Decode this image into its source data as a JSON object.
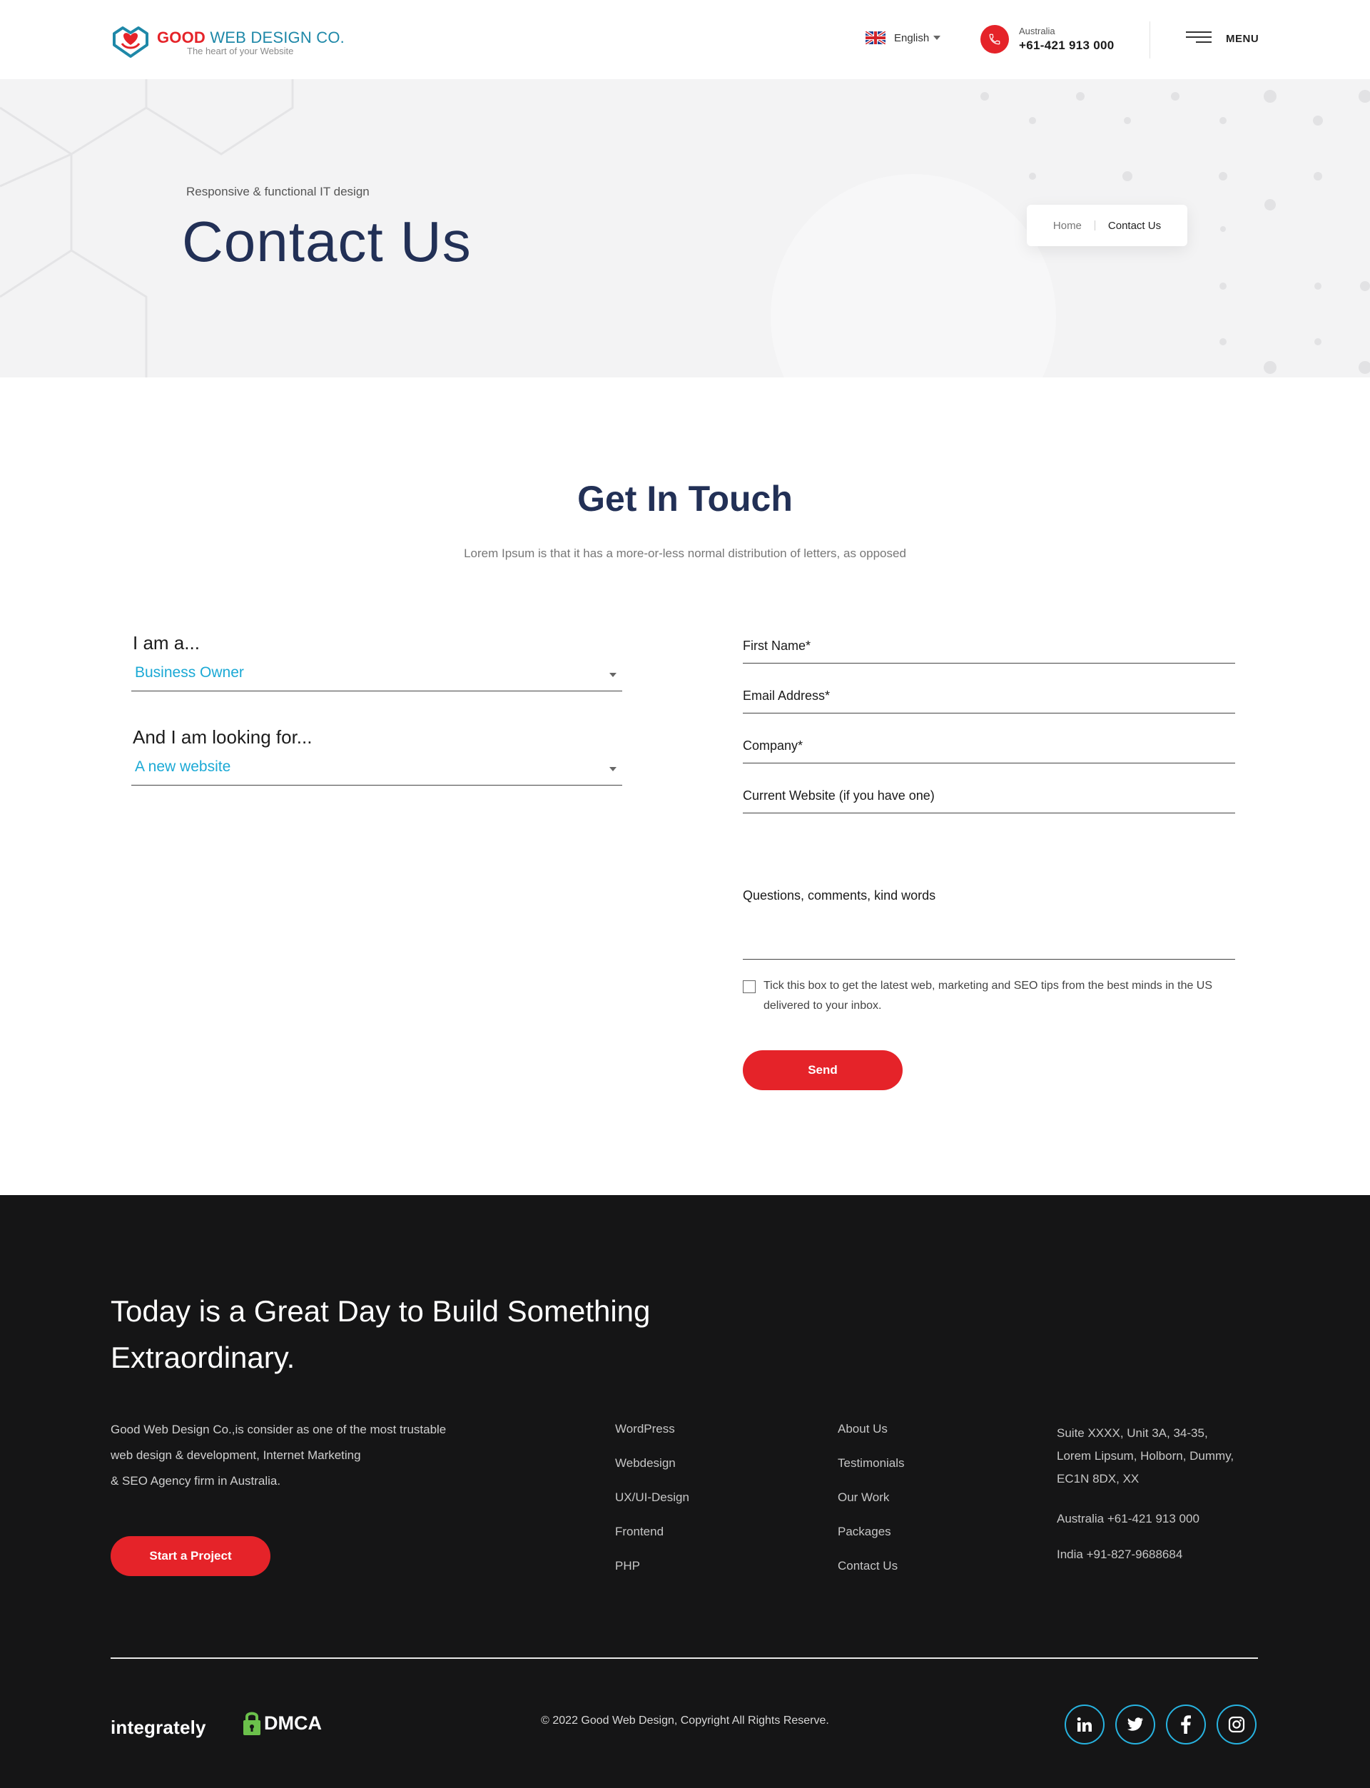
{
  "header": {
    "logo": {
      "title_bold": "GOOD",
      "title_rest": " WEB DESIGN CO.",
      "tagline": "The heart of your Website"
    },
    "language": {
      "selected": "English",
      "icon": "uk-flag-icon"
    },
    "phone": {
      "country": "Australia",
      "number": "+61-421 913 000",
      "icon": "phone-icon"
    },
    "menu_label": "MENU"
  },
  "hero": {
    "subtitle": "Responsive & functional IT design",
    "title": "Contact Us",
    "breadcrumb": {
      "home": "Home",
      "current": "Contact Us"
    }
  },
  "contact": {
    "title": "Get In Touch",
    "subtitle": "Lorem Ipsum is that it has a more-or-less normal distribution of letters, as opposed",
    "q1": {
      "label": "I am a...",
      "value": "Business Owner"
    },
    "q2": {
      "label": "And I am looking for...",
      "value": "A new website"
    },
    "fields": {
      "first_name": "First Name*",
      "email": "Email Address*",
      "company": "Company*",
      "website": "Current Website (if you have one)",
      "comments": "Questions, comments, kind words"
    },
    "newsletter": "Tick this box to get the latest web, marketing and SEO tips from the best minds in the US delivered to your inbox.",
    "send_label": "Send"
  },
  "footer": {
    "headline": "Today is a Great Day to Build Something Extraordinary.",
    "about": [
      "Good Web Design Co.,is consider as one of the most trustable",
      "web design & development, Internet Marketing",
      "& SEO Agency firm in Australia."
    ],
    "cta": "Start a Project",
    "services": [
      "WordPress",
      "Webdesign",
      "UX/UI-Design",
      "Frontend",
      "PHP"
    ],
    "company": [
      "About Us",
      "Testimonials",
      "Our Work",
      "Packages",
      "Contact Us"
    ],
    "address": [
      "Suite XXXX, Unit 3A, 34-35,",
      "Lorem Lipsum, Holborn, Dummy,",
      "EC1N 8DX, XX"
    ],
    "phone_au": "Australia +61-421 913 000",
    "phone_in": "India +91-827-9688684",
    "badges": {
      "integrately": "integrately",
      "dmca": "DMCA"
    },
    "copyright": "© 2022 Good Web Design, Copyright All Rights Reserve.",
    "socials": [
      "linkedin-icon",
      "twitter-icon",
      "facebook-icon",
      "instagram-icon"
    ]
  },
  "colors": {
    "accent": "#e52329",
    "navy": "#223056",
    "select_text": "#1ba9d5",
    "footer_bg": "#151516",
    "social_ring": "#27b3e0"
  }
}
